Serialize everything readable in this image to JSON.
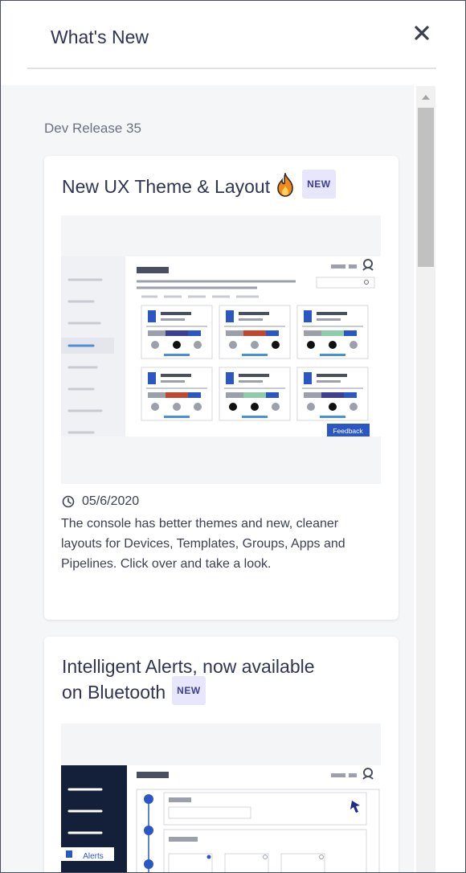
{
  "panel": {
    "title": "What's New",
    "close_icon": "close-icon"
  },
  "feed": {
    "section_label": "Dev Release 35",
    "cards": [
      {
        "title": "New UX Theme & Layout",
        "emoji_icon": "fire-icon",
        "badge": "NEW",
        "date": "05/6/2020",
        "description": "The console has better themes and new, cleaner layouts for Devices, Templates, Groups, Apps and Pipelines. Click over and take a look.",
        "screenshot": {
          "feedback_label": "Feedback"
        }
      },
      {
        "title_line1": "Intelligent Alerts, now available",
        "title_line2": "on Bluetooth",
        "badge": "NEW",
        "screenshot": {
          "alerts_label": "Alerts"
        }
      }
    ]
  },
  "colors": {
    "title_text": "#2f3552",
    "badge_bg": "#e7e6fa",
    "badge_text": "#3d3f92",
    "accent_blue": "#2a57c4"
  }
}
